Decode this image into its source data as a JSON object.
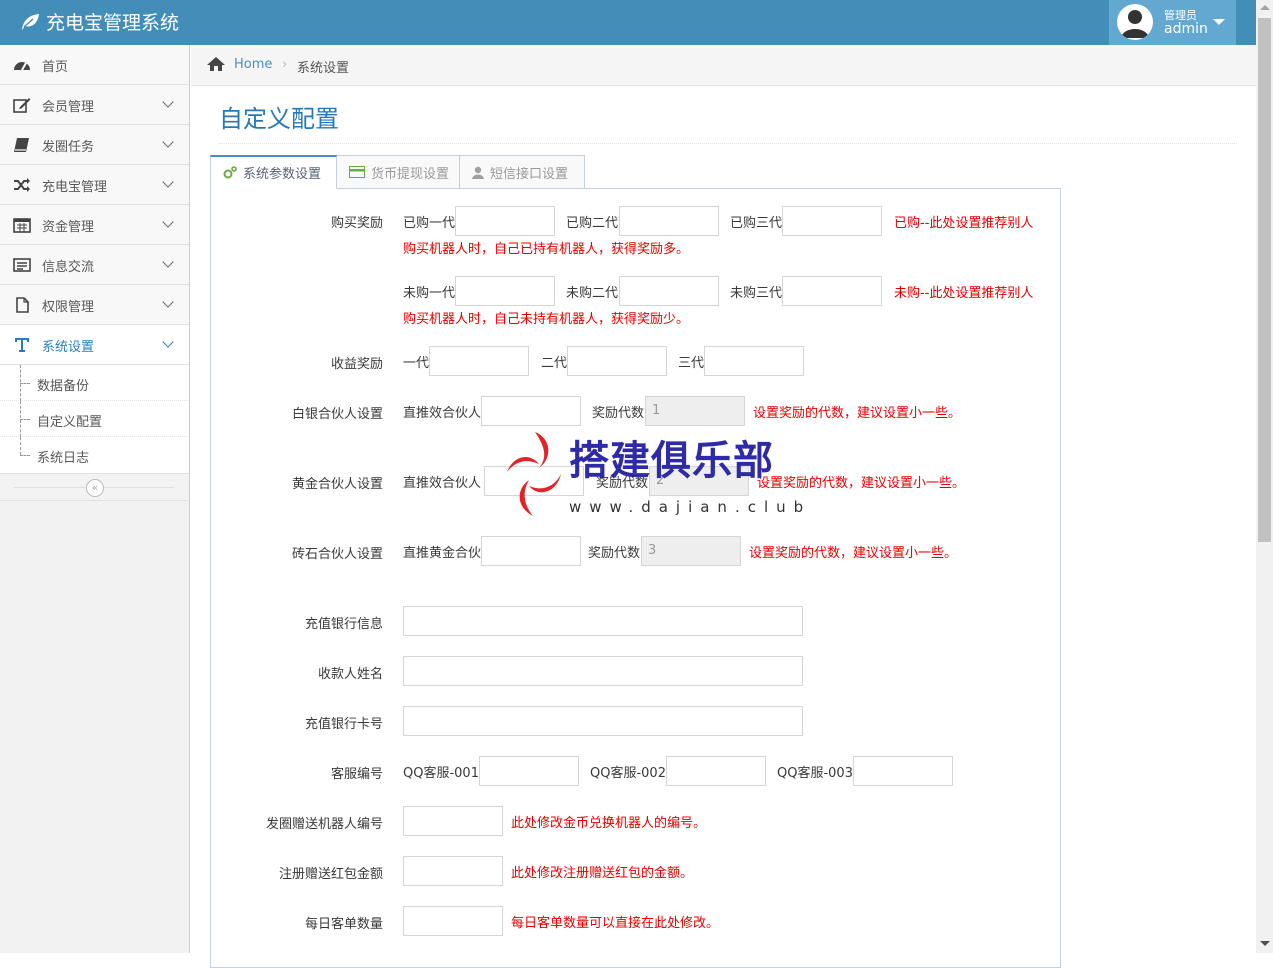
{
  "app": {
    "title": "充电宝管理系统"
  },
  "user": {
    "role": "管理员",
    "name": "admin"
  },
  "sidebar": {
    "items": [
      {
        "label": "首页",
        "icon": "dashboard-icon"
      },
      {
        "label": "会员管理",
        "icon": "edit-icon"
      },
      {
        "label": "发圈任务",
        "icon": "book-icon"
      },
      {
        "label": "充电宝管理",
        "icon": "shuffle-icon"
      },
      {
        "label": "资金管理",
        "icon": "calendar-icon"
      },
      {
        "label": "信息交流",
        "icon": "list-icon"
      },
      {
        "label": "权限管理",
        "icon": "file-icon"
      },
      {
        "label": "系统设置",
        "icon": "text-icon"
      }
    ],
    "subitems": [
      "数据备份",
      "自定义配置",
      "系统日志"
    ]
  },
  "breadcrumb": {
    "home": "Home",
    "current": "系统设置"
  },
  "page": {
    "title": "自定义配置"
  },
  "tabs": [
    {
      "label": "系统参数设置",
      "icon": "cogs-icon"
    },
    {
      "label": "货币提现设置",
      "icon": "credit-card-icon"
    },
    {
      "label": "短信接口设置",
      "icon": "user-icon"
    }
  ],
  "form": {
    "purchase_reward": {
      "label": "购买奖励",
      "bought": [
        "已购一代",
        "已购二代",
        "已购三代"
      ],
      "bought_note_1": "已购--此处设置推荐别人",
      "bought_note_2": "购买机器人时，自己已持有机器人，获得奖励多。",
      "unbought": [
        "未购一代",
        "未购二代",
        "未购三代"
      ],
      "unbought_note_1": "未购--此处设置推荐别人",
      "unbought_note_2": "购买机器人时，自己未持有机器人，获得奖励少。"
    },
    "income_reward": {
      "label": "收益奖励",
      "gens": [
        "一代",
        "二代",
        "三代"
      ]
    },
    "silver": {
      "label": "白银合伙人设置",
      "direct": "直推效合伙人",
      "gens_label": "奖励代数",
      "gens_value": "1",
      "note": "设置奖励的代数，建议设置小一些。"
    },
    "gold": {
      "label": "黄金合伙人设置",
      "direct": "直推效合伙人",
      "gens_label": "奖励代数",
      "gens_value": "2",
      "note": "设置奖励的代数，建议设置小一些。"
    },
    "diamond": {
      "label": "砖石合伙人设置",
      "direct": "直推黄金合伙",
      "gens_label": "奖励代数",
      "gens_value": "3",
      "note": "设置奖励的代数，建议设置小一些。"
    },
    "bank_info": {
      "label": "充值银行信息"
    },
    "payee": {
      "label": "收款人姓名"
    },
    "card_no": {
      "label": "充值银行卡号"
    },
    "service": {
      "label": "客服编号",
      "items": [
        "QQ客服-001",
        "QQ客服-002",
        "QQ客服-003"
      ]
    },
    "robot_no": {
      "label": "发圈赠送机器人编号",
      "note": "此处修改金币兑换机器人的编号。"
    },
    "red_packet": {
      "label": "注册赠送红包金额",
      "note": "此处修改注册赠送红包的金额。"
    },
    "daily_orders": {
      "label": "每日客单数量",
      "note": "每日客单数量可以直接在此处修改。"
    }
  },
  "watermark": {
    "title": "搭建俱乐部",
    "url": "www.dajian.club"
  },
  "colors": {
    "navbar": "#438eb9",
    "user_box": "#62a8d1",
    "link": "#2679b5",
    "note": "#e40000"
  }
}
